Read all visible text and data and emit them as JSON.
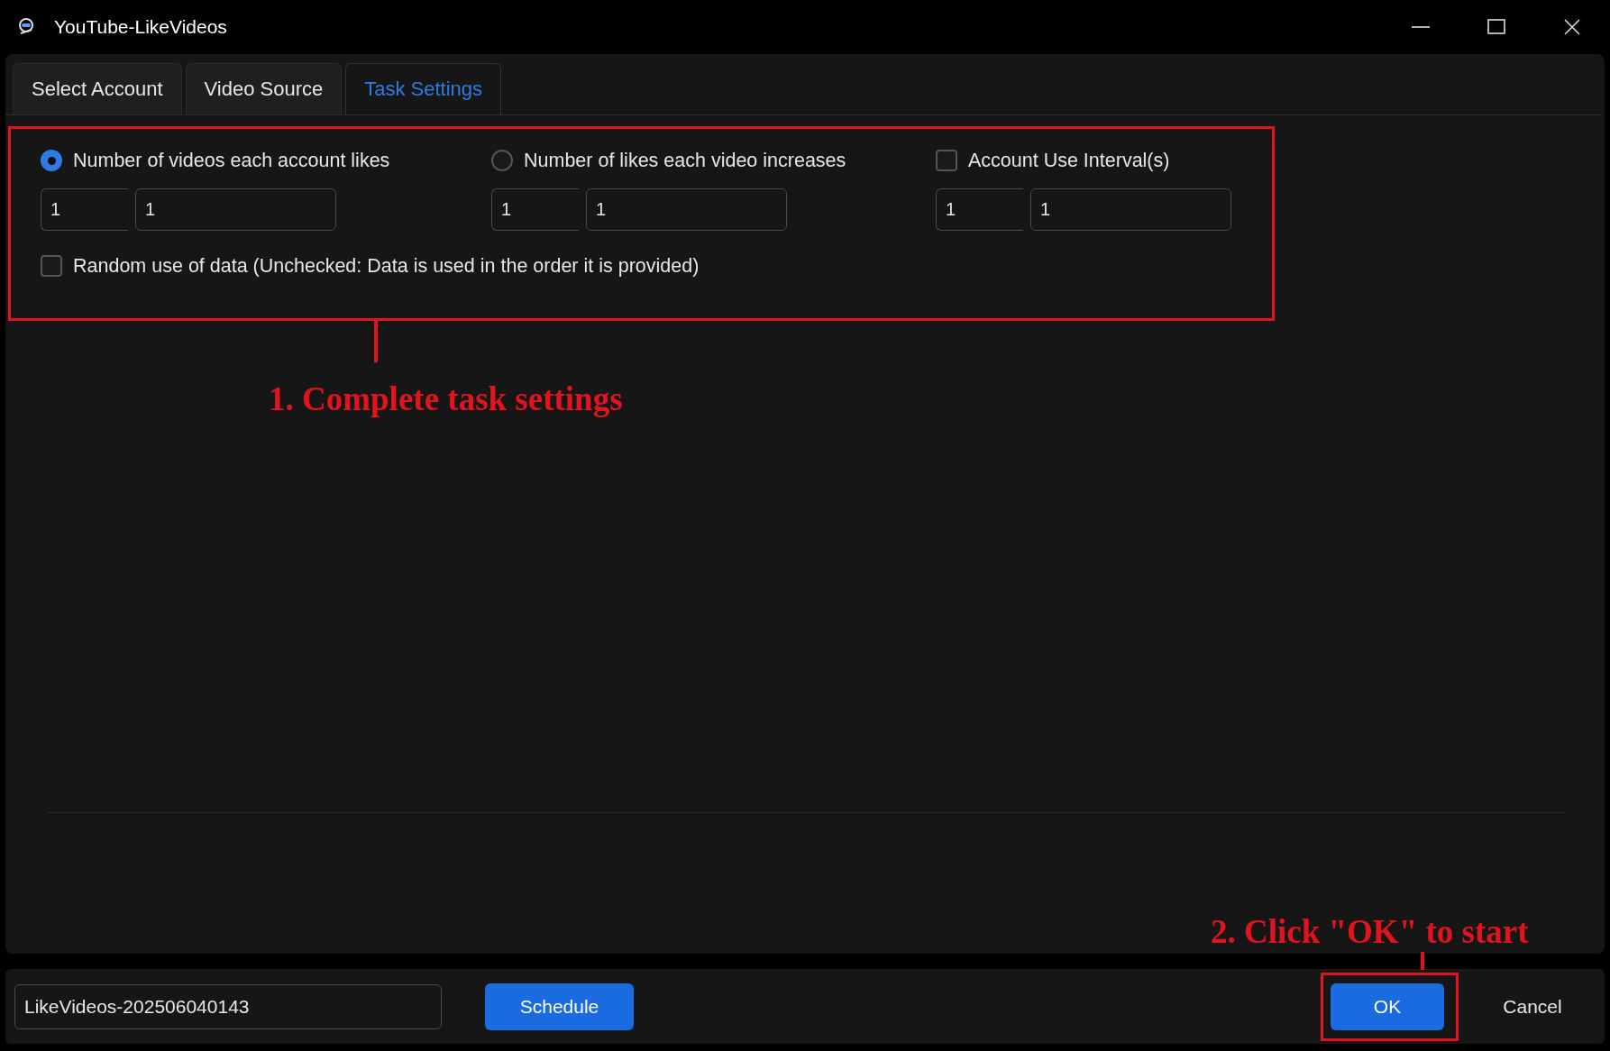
{
  "window": {
    "title": "YouTube-LikeVideos"
  },
  "tabs": [
    {
      "label": "Select Account",
      "selected": false
    },
    {
      "label": "Video Source",
      "selected": false
    },
    {
      "label": "Task Settings",
      "selected": true
    }
  ],
  "settings": {
    "options": [
      {
        "kind": "radio",
        "label": "Number of videos each account likes",
        "selected": true,
        "values": [
          "1",
          "1"
        ]
      },
      {
        "kind": "radio",
        "label": "Number of likes each video increases",
        "selected": false,
        "values": [
          "1",
          "1"
        ]
      },
      {
        "kind": "checkbox",
        "label": "Account Use Interval(s)",
        "checked": false,
        "values": [
          "1",
          "1"
        ]
      }
    ],
    "random": {
      "label": "Random use of data (Unchecked: Data is used in the order it is provided)",
      "checked": false
    }
  },
  "bottom_bar": {
    "task_name": "LikeVideos-202506040143",
    "schedule_button": "Schedule",
    "ok_button": "OK",
    "cancel_button": "Cancel"
  },
  "annotations": [
    {
      "text": "1. Complete task settings"
    },
    {
      "text": "2. Click \"OK\" to start"
    }
  ]
}
